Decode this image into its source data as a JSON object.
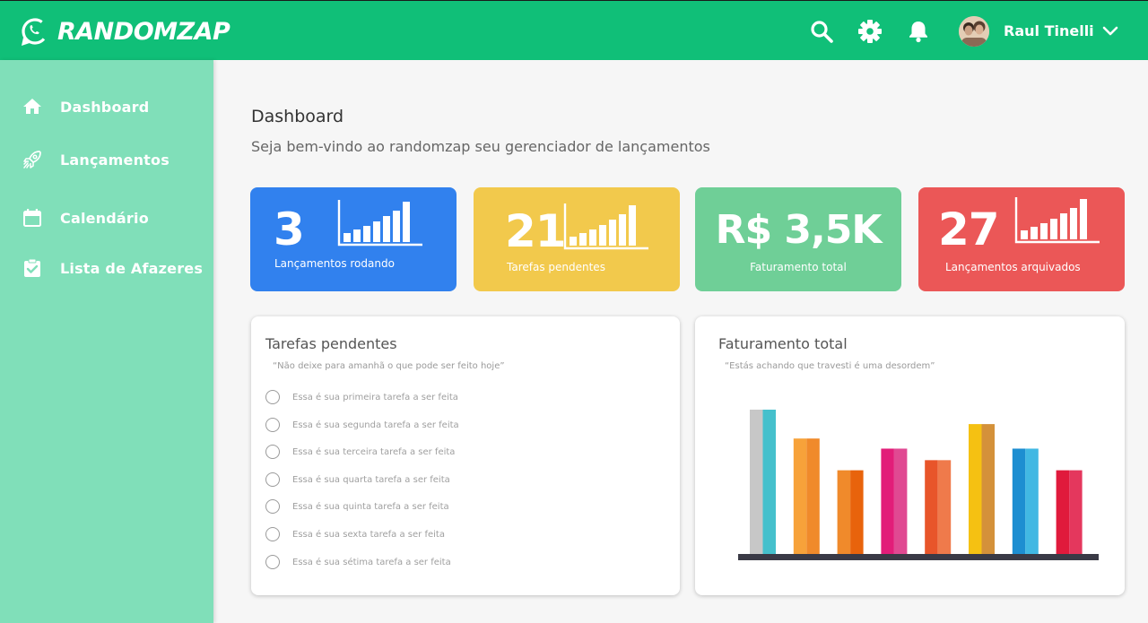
{
  "header": {
    "brand": "RANDOMZAP",
    "icons": [
      "search-icon",
      "gear-icon",
      "bell-icon",
      "chevron-down-icon"
    ],
    "user_name": "Raul Tinelli",
    "color": "#10bf78"
  },
  "sidebar": {
    "color": "#80dfb9",
    "items": [
      {
        "label": "Dashboard",
        "icon": "home-icon"
      },
      {
        "label": "Lançamentos",
        "icon": "rocket-icon"
      },
      {
        "label": "Calendário",
        "icon": "calendar-icon"
      },
      {
        "label": "Lista de Afazeres",
        "icon": "clipboard-check-icon"
      }
    ]
  },
  "main": {
    "title": "Dashboard",
    "subtitle": "Seja bem-vindo ao randomzap seu gerenciador de lançamentos"
  },
  "cards": [
    {
      "value": "3",
      "label": "Lançamentos rodando",
      "color": "#3181ee",
      "icon": "bar-chart-icon"
    },
    {
      "value": "21",
      "label": "Tarefas pendentes",
      "color": "#f2c94c",
      "icon": "bar-chart-icon"
    },
    {
      "value": "R$ 3,5K",
      "label": "Faturamento total",
      "color": "#6fcf97",
      "icon": ""
    },
    {
      "value": "27",
      "label": "Lançamentos arquivados",
      "color": "#eb5757",
      "icon": "bar-chart-icon"
    }
  ],
  "tasks_panel": {
    "title": "Tarefas pendentes",
    "quote": "“Não deixe para amanhã o que pode ser feito hoje”",
    "tasks": [
      "Essa é sua primeira tarefa a ser feita",
      "Essa é sua segunda tarefa a ser feita",
      "Essa é sua terceira tarefa a ser feita",
      "Essa é sua quarta tarefa a ser feita",
      "Essa é sua quinta tarefa a ser feita",
      "Essa é sua sexta tarefa a ser feita",
      "Essa é sua sétima tarefa a ser feita"
    ]
  },
  "revenue_panel": {
    "title": "Faturamento total",
    "quote": "“Estás achando que travesti é uma desordem”"
  },
  "chart_data": {
    "type": "bar",
    "title": "Faturamento total",
    "values": [
      100,
      80,
      58,
      73,
      65,
      90,
      73,
      58
    ],
    "ylim": [
      0,
      100
    ],
    "colors": [
      [
        "#c7c7c7",
        "#45c0cc"
      ],
      [
        "#f7a23a",
        "#f08a2b"
      ],
      [
        "#f08a2b",
        "#e8630c"
      ],
      [
        "#e21d79",
        "#e04992"
      ],
      [
        "#e8552a",
        "#ef7a4b"
      ],
      [
        "#f5c112",
        "#d4913a"
      ],
      [
        "#1d8ed1",
        "#41b8e3"
      ],
      [
        "#e01a3c",
        "#e4375d"
      ]
    ],
    "baseline_color": "#3a3a46"
  }
}
